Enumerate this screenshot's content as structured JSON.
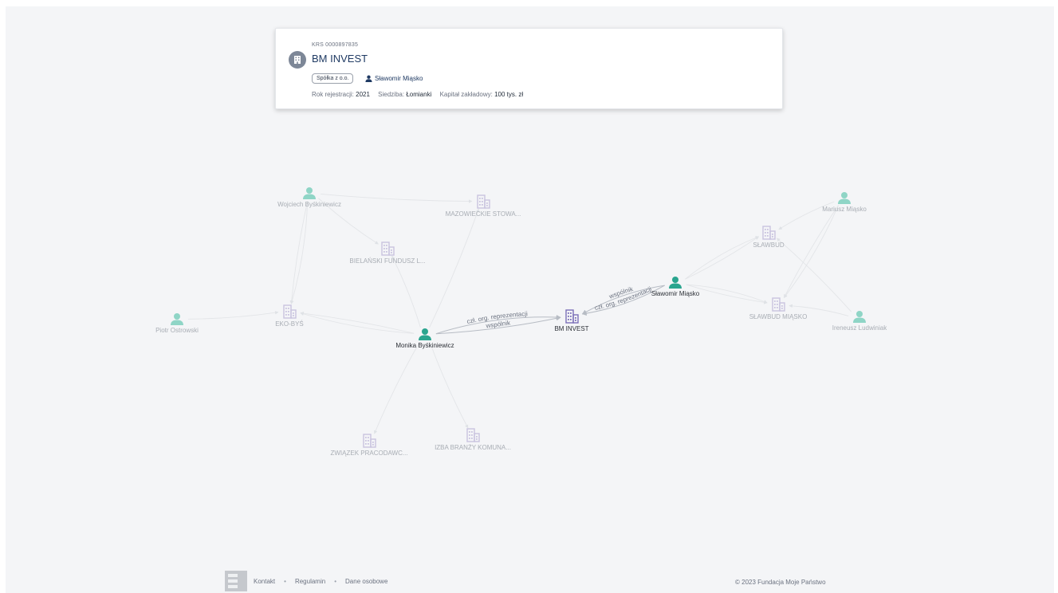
{
  "card": {
    "krs": "KRS 0000897835",
    "title": "BM INVEST",
    "legal_form": "Spółka z o.o.",
    "person": "Sławomir Miąsko",
    "reg_year_label": "Rok rejestracji:",
    "reg_year": "2021",
    "seat_label": "Siedziba:",
    "seat": "Łomianki",
    "capital_label": "Kapitał zakładowy:",
    "capital": "100 tys. zł"
  },
  "graph": {
    "colors": {
      "person_active": "#2aa58f",
      "person_faded": "#8fd5c6",
      "company_active": "#7b6fb8",
      "company_faded": "#c9c3df",
      "edge": "#b7bcc4",
      "edge_faded": "#e3e5e8",
      "label_active": "#2b2f36",
      "label_faded": "#a8adb4"
    },
    "nodes": [
      {
        "id": "wojciech",
        "type": "person",
        "label": "Wojciech Byśkiniewicz",
        "active": false
      },
      {
        "id": "mazowieckie",
        "type": "company",
        "label": "MAZOWIECKIE STOWA...",
        "active": false
      },
      {
        "id": "bielanski",
        "type": "company",
        "label": "BIELAŃSKI FUNDUSZ L...",
        "active": false
      },
      {
        "id": "piotr",
        "type": "person",
        "label": "Piotr Ostrowski",
        "active": false
      },
      {
        "id": "ekobys",
        "type": "company",
        "label": "EKO-BYŚ",
        "active": false
      },
      {
        "id": "monika",
        "type": "person",
        "label": "Monika Byśkiniewicz",
        "active": true
      },
      {
        "id": "bminvest",
        "type": "company",
        "label": "BM INVEST",
        "active": true
      },
      {
        "id": "slawomir",
        "type": "person",
        "label": "Sławomir Miąsko",
        "active": true
      },
      {
        "id": "slawbud",
        "type": "company",
        "label": "SŁAWBUD",
        "active": false
      },
      {
        "id": "mariusz",
        "type": "person",
        "label": "Mariusz Miąsko",
        "active": false
      },
      {
        "id": "slawbud_miasko",
        "type": "company",
        "label": "SŁAWBUD MIĄSKO",
        "active": false
      },
      {
        "id": "ireneusz",
        "type": "person",
        "label": "Ireneusz Ludwiniak",
        "active": false
      },
      {
        "id": "zwiazek",
        "type": "company",
        "label": "ZWIĄZEK PRACODAWC...",
        "active": false
      },
      {
        "id": "izba",
        "type": "company",
        "label": "IZBA BRANŻY KOMUNA...",
        "active": false
      }
    ],
    "edges": [
      {
        "from": "monika",
        "to": "bminvest",
        "label": "czł. org. reprezentacji",
        "active": true
      },
      {
        "from": "monika",
        "to": "bminvest",
        "label": "wspólnik",
        "active": true
      },
      {
        "from": "slawomir",
        "to": "bminvest",
        "label": "czł. org. reprezentacji",
        "active": true
      },
      {
        "from": "slawomir",
        "to": "bminvest",
        "label": "wspólnik",
        "active": true
      },
      {
        "from": "wojciech",
        "to": "mazowieckie",
        "label": "",
        "active": false
      },
      {
        "from": "wojciech",
        "to": "bielanski",
        "label": "",
        "active": false
      },
      {
        "from": "wojciech",
        "to": "ekobys",
        "label": "",
        "active": false
      },
      {
        "from": "wojciech",
        "to": "ekobys",
        "label": "",
        "active": false
      },
      {
        "from": "piotr",
        "to": "ekobys",
        "label": "",
        "active": false
      },
      {
        "from": "monika",
        "to": "ekobys",
        "label": "",
        "active": false
      },
      {
        "from": "monika",
        "to": "ekobys",
        "label": "",
        "active": false
      },
      {
        "from": "monika",
        "to": "bielanski",
        "label": "",
        "active": false
      },
      {
        "from": "monika",
        "to": "mazowieckie",
        "label": "",
        "active": false
      },
      {
        "from": "monika",
        "to": "zwiazek",
        "label": "",
        "active": false
      },
      {
        "from": "monika",
        "to": "izba",
        "label": "",
        "active": false
      },
      {
        "from": "slawomir",
        "to": "slawbud",
        "label": "",
        "active": false
      },
      {
        "from": "slawomir",
        "to": "slawbud",
        "label": "",
        "active": false
      },
      {
        "from": "slawomir",
        "to": "slawbud_miasko",
        "label": "",
        "active": false
      },
      {
        "from": "slawomir",
        "to": "slawbud_miasko",
        "label": "",
        "active": false
      },
      {
        "from": "mariusz",
        "to": "slawbud",
        "label": "",
        "active": false
      },
      {
        "from": "mariusz",
        "to": "slawbud_miasko",
        "label": "",
        "active": false
      },
      {
        "from": "mariusz",
        "to": "slawbud_miasko",
        "label": "",
        "active": false
      },
      {
        "from": "ireneusz",
        "to": "slawbud_miasko",
        "label": "",
        "active": false
      },
      {
        "from": "ireneusz",
        "to": "slawbud",
        "label": "",
        "active": false
      }
    ]
  },
  "footer": {
    "links": [
      "Kontakt",
      "Regulamin",
      "Dane osobowe"
    ],
    "copyright": "© 2023 Fundacja Moje Państwo"
  }
}
